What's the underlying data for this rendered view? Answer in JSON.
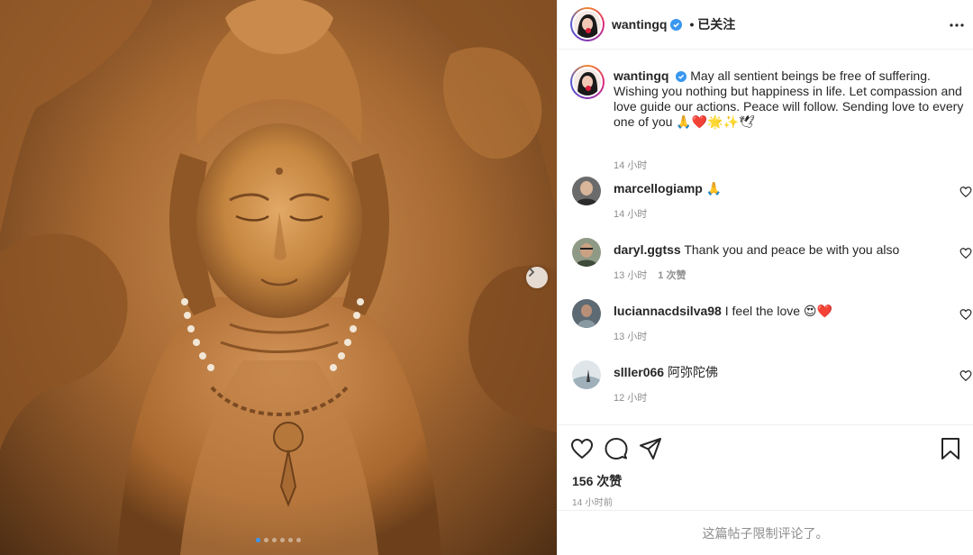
{
  "post": {
    "username": "wantingq",
    "follow_state": "已关注",
    "caption": "May all sentient beings be free of suffering. Wishing you nothing but happiness in life. Let compassion and love guide our actions. Peace will follow. Sending love to every one of you 🙏❤️🌟✨🕊",
    "caption_time": "14 小时",
    "likes": "156 次赞",
    "post_time": "14 小时前",
    "comments_restricted": "这篇帖子限制评论了。",
    "carousel": {
      "total": 6,
      "active_index": 0
    }
  },
  "comments": [
    {
      "username": "marcellogiamp",
      "text": "🙏",
      "time": "14 小时",
      "likes": ""
    },
    {
      "username": "daryl.ggtss",
      "text": "Thank you and peace be with you also",
      "time": "13 小时",
      "likes": "1 次赞"
    },
    {
      "username": "luciannacdsilva98",
      "text": "I feel the love 😍❤️",
      "time": "13 小时",
      "likes": ""
    },
    {
      "username": "slller066",
      "text": "阿弥陀佛",
      "time": "12 小时",
      "likes": ""
    }
  ],
  "colors": {
    "verified_blue": "#3897f0",
    "text_primary": "#262626",
    "text_secondary": "#8e8e8e",
    "divider": "#efefef"
  },
  "icons": [
    "verified-badge-icon",
    "more-options-icon",
    "next-arrow-icon",
    "heart-icon",
    "comment-icon",
    "share-icon",
    "bookmark-icon"
  ]
}
